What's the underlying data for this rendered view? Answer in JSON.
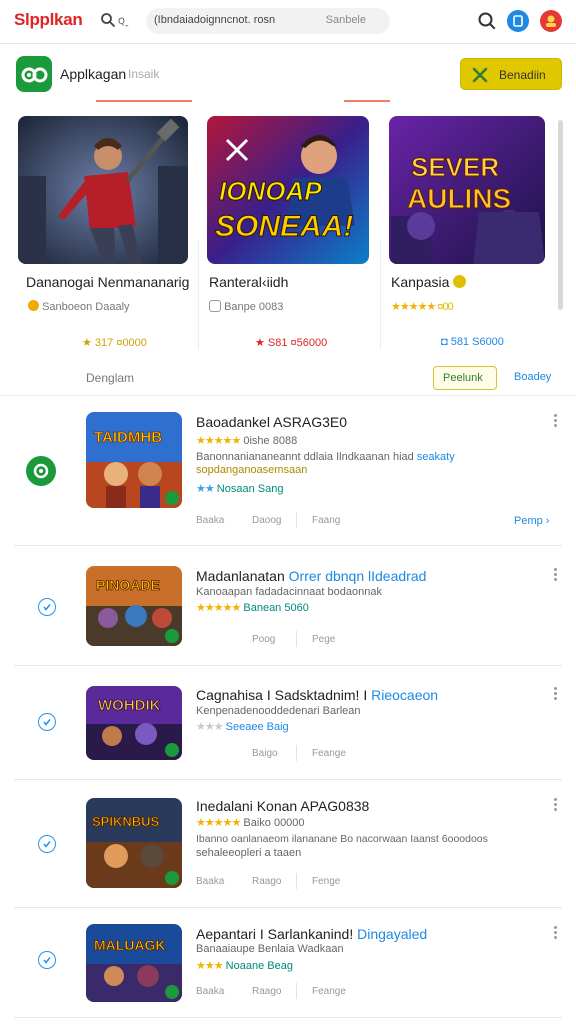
{
  "topbar": {
    "logo": "Slpplkan",
    "search_hint": "ꞯꞈ",
    "url": "(Ibndaiadoignncnot. rosn",
    "url_action": "Sanbele"
  },
  "app_header": {
    "title": "Applkagan",
    "subtitle": "Insaik",
    "download_label": "Benadiin"
  },
  "featured": [
    {
      "poster_title": "",
      "title": "Dananogai Nenmananarig",
      "sub": "Sanboeon Daaaly",
      "price": "★ 317 ¤0000",
      "accent": "#d4a000"
    },
    {
      "poster_title": "IONOAP SONEAA!",
      "title": "Ranteral‹iidh",
      "sub": "Banpe 0083",
      "price": "★ S81 ¤56000",
      "accent": "#e02424"
    },
    {
      "poster_title": "SEVER AULINS",
      "title": "Kanpasia",
      "sub": "★★★★★ ¤00",
      "price": "◘ 581 S6000",
      "accent": "#1e88e5"
    }
  ],
  "filter": {
    "label": "Denglam",
    "button": "Peelunk",
    "link": "Boadey"
  },
  "list": [
    {
      "thumb_text": "TAIDMHB",
      "title": "Baoadankel ASRAG3E0",
      "title_accent": "",
      "rating": "★★★★★",
      "rating_text": "0ishe 8088",
      "desc1": "Banonnaniananeannt ddlaia Ilndkaanan hiad",
      "desc1_accent": "seakaty",
      "desc2": "sopdanganoasemsaan",
      "meta_stars": "★★",
      "meta": "Nosaan Sang",
      "mini1": "Baaka",
      "mini2": "Daoog",
      "mini3": "Faang",
      "action": "Pemp ›"
    },
    {
      "thumb_text": "PINOADE",
      "title": "Madanlanatan",
      "title_accent": "Orrer dbnqn lIdeadrad",
      "rating": "",
      "rating_text": "",
      "desc1": "Kanoaapan fadadacinnaat bodaonnak",
      "desc1_accent": "",
      "desc2": "",
      "meta_stars": "★★★★★",
      "meta": "Banean 5060",
      "mini1": "",
      "mini2": "Poog",
      "mini3": "Pege",
      "action": ""
    },
    {
      "thumb_text": "WOHDIK",
      "title": "Cagnahisa I Sadsktadnim! I",
      "title_accent": "Rieocaeon",
      "rating": "",
      "rating_text": "",
      "desc1": "Kenpenadenooddedenari Barlean",
      "desc1_accent": "",
      "desc2": "",
      "meta_stars": "★★★",
      "meta": "Seeaee Baig",
      "mini1": "",
      "mini2": "Baigo",
      "mini3": "Feange",
      "action": ""
    },
    {
      "thumb_text": "SPIKNBUS",
      "title": "Inedalani Konan APAG0838",
      "title_accent": "",
      "rating": "★★★★★",
      "rating_text": "Baiko 00000",
      "desc1": "Ibanno oanlanaeom ilananane Bo nacorwaan Iaanst 6ooodoos",
      "desc1_accent": "",
      "desc2": "sehaleeopleri a taaen",
      "meta_stars": "",
      "meta": "",
      "mini1": "Baaka",
      "mini2": "Raago",
      "mini3": "Fenge",
      "action": ""
    },
    {
      "thumb_text": "MALUAGK",
      "title": "Aepantari I Sarlankanind!",
      "title_accent": "Dingayaled",
      "rating": "",
      "rating_text": "",
      "desc1": "Banaaiaupe  Benlaia Wadkaan",
      "desc1_accent": "",
      "desc2": "",
      "meta_stars": "★★★",
      "meta": "Noaane Beag",
      "mini1": "Baaka",
      "mini2": "Raago",
      "mini3": "Feange",
      "action": ""
    }
  ],
  "colors": {
    "brand_red": "#e02424",
    "download_yellow": "#e0c800",
    "accent_blue": "#1e88e5",
    "green": "#1b9a3c"
  }
}
